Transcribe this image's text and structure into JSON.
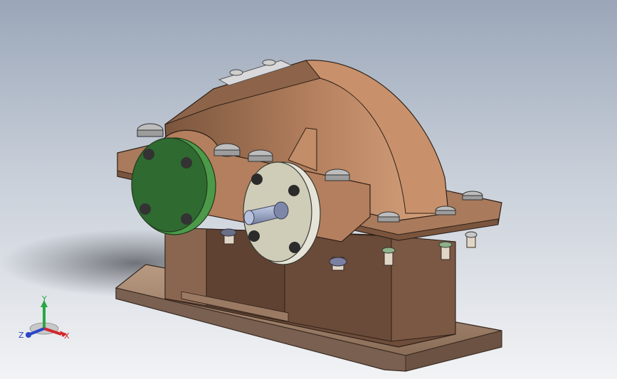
{
  "viewport": {
    "background_top": "#9aa6b8",
    "background_bottom": "#f2f3f5",
    "model_colors": {
      "housing": "#b78260",
      "housing_dark": "#6e4d3a",
      "cover_flange": "#2f6a31",
      "shaft_flange": "#d7d4c2",
      "shaft": "#9aa7c6",
      "bolt": "#c9c9c9"
    }
  },
  "triad": {
    "x_label": "X",
    "y_label": "Y",
    "z_label": "Z",
    "x_color": "#d2272b",
    "y_color": "#29a744",
    "z_color": "#2946c8"
  }
}
